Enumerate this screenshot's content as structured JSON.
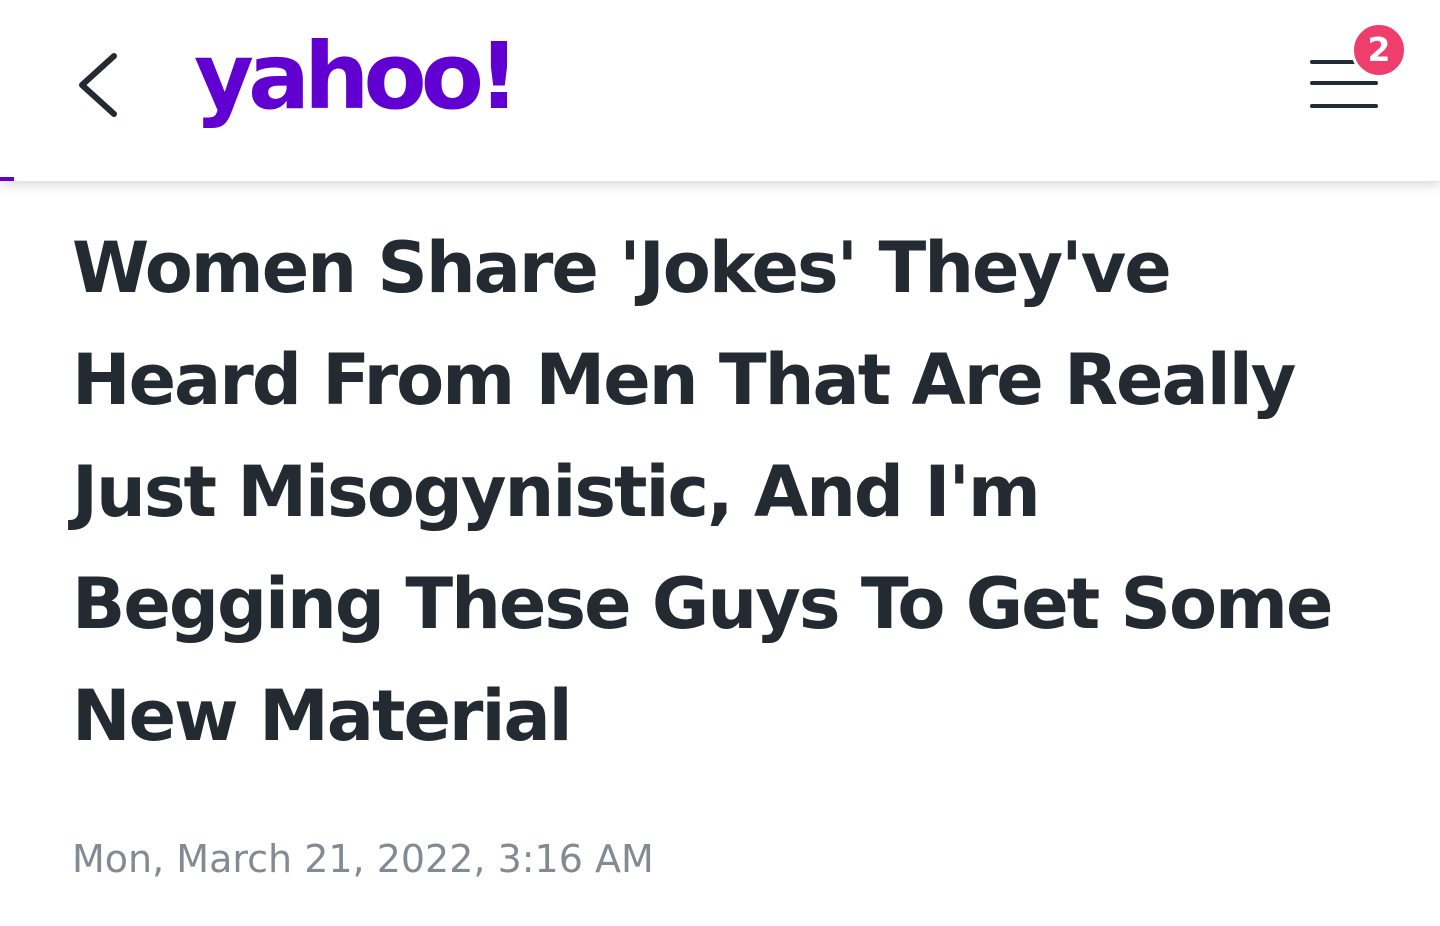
{
  "header": {
    "logo_text": "yahoo!",
    "brand_color": "#6001d2",
    "notification_count": "2",
    "badge_color": "#ef3e6c",
    "back_icon": "chevron-left-icon",
    "menu_icon": "hamburger-menu-icon",
    "reading_progress": 0.01
  },
  "article": {
    "title": "Women Share 'Jokes' They've Heard From Men That Are Really Just Misogynistic, And I'm Begging These Guys To Get Some New Material",
    "date": "Mon, March 21, 2022, 3:16 AM",
    "title_color": "#232a31",
    "date_color": "#828a93"
  }
}
